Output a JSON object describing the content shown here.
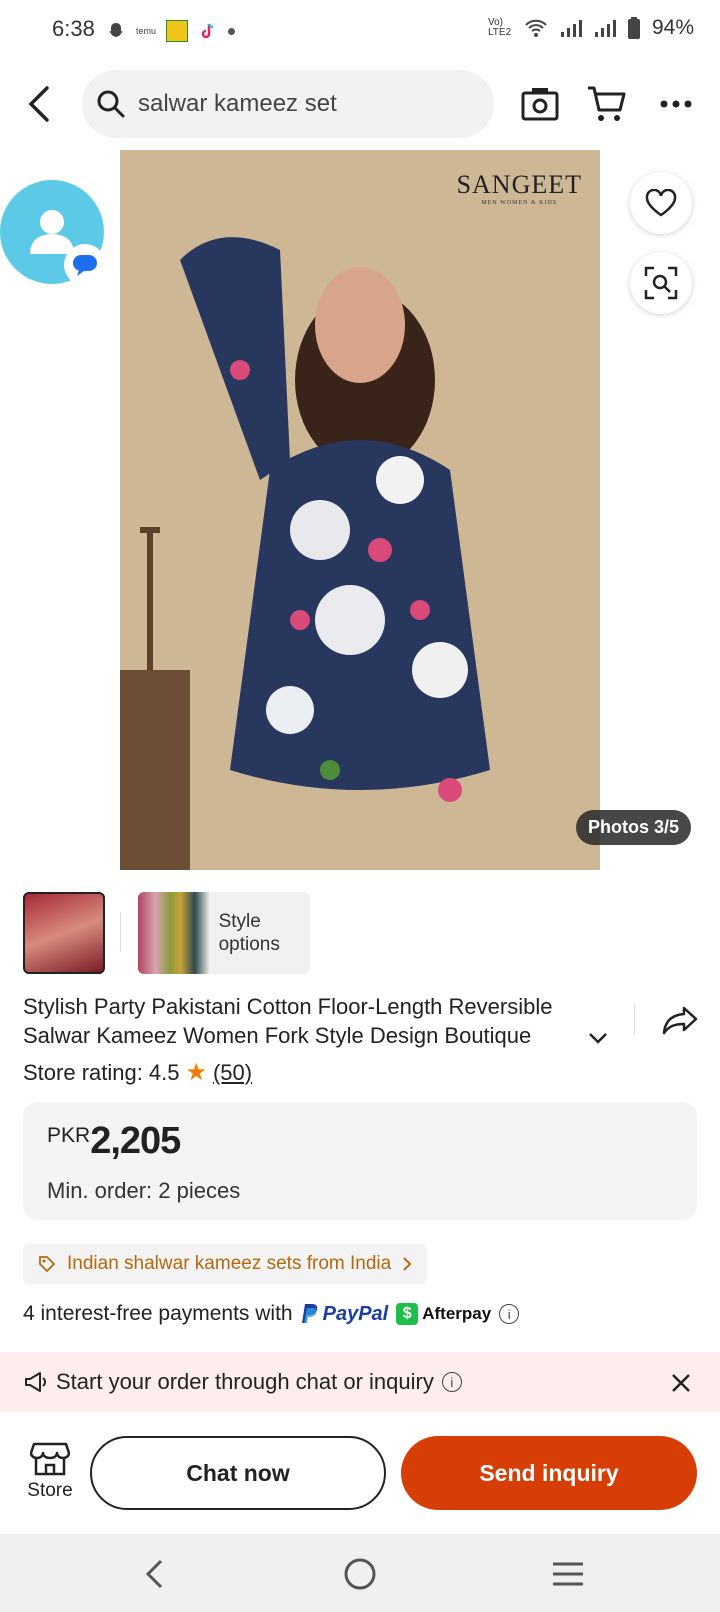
{
  "status_bar": {
    "time": "6:38",
    "network": "Vo) LTE2",
    "battery": "94%"
  },
  "header": {
    "search_query": "salwar kameez set",
    "icons": [
      "back-arrow-icon",
      "search-icon",
      "camera-icon",
      "cart-icon",
      "more-icon"
    ]
  },
  "gallery": {
    "brand_name": "SANGEET",
    "brand_tagline": "MEN WOMEN & KIDS",
    "photos_counter": "Photos 3/5",
    "style_options_label": "Style options"
  },
  "product": {
    "title": "Stylish Party Pakistani Cotton Floor-Length Reversible Salwar Kameez Women Fork Style Design Boutique",
    "rating_label": "Store rating:",
    "rating_value": "4.5",
    "rating_count": "(50)",
    "currency": "PKR",
    "price": "2,205",
    "min_order": "Min. order: 2 pieces",
    "promo_link": "Indian shalwar kameez sets from India",
    "payment_text": "4 interest-free payments with",
    "paypal_label": "PayPal",
    "afterpay_label": "Afterpay"
  },
  "chat_banner": {
    "text": "Start your order through chat or inquiry"
  },
  "bottom_bar": {
    "store_label": "Store",
    "chat_label": "Chat now",
    "inquiry_label": "Send inquiry"
  },
  "colors": {
    "accent": "#d63e06",
    "promo_text": "#b5670f",
    "banner_bg": "#fdeded",
    "avatar_bg": "#5cc9e6"
  }
}
